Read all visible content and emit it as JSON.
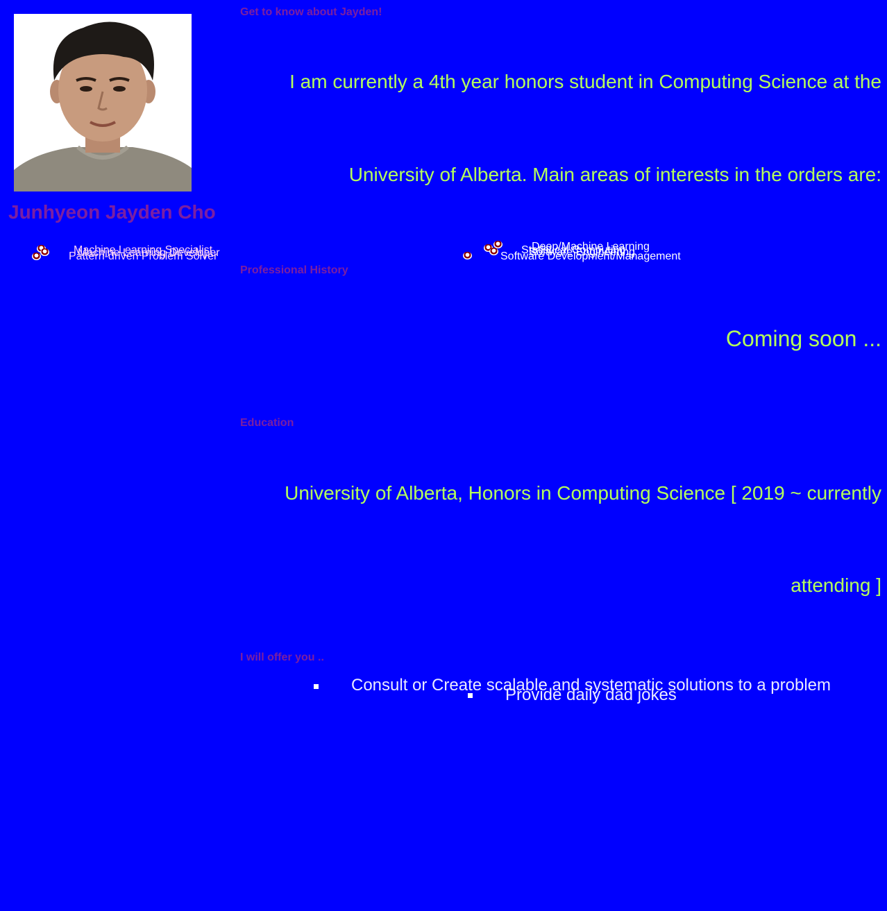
{
  "sidebar": {
    "photo_alt": "Profile photo of Junhyeon Jayden Cho",
    "name": "Junhyeon Jayden Cho",
    "skills_left": [
      "Machine Learning Specialist",
      "Machine Learning Developer",
      "Pattern-driven Problem Solver"
    ]
  },
  "skills_right": [
    "Deep/Machine Learning",
    "Statistical Computing",
    "Software Development/Management",
    "Software Engineering"
  ],
  "about": {
    "title": "Get to know about Jayden!",
    "line1": "I am currently a 4th year honors student in Computing Science at the",
    "line2": "University of Alberta. Main areas of interests in the orders are:"
  },
  "professional": {
    "title": "Professional History",
    "text": "Coming soon ..."
  },
  "education": {
    "title": "Education",
    "line1": "University of Alberta, Honors in Computing Science [ 2019 ~ currently",
    "line2": "attending ]"
  },
  "offer": {
    "title": "I will offer you ..",
    "items": [
      "Consult or Create scalable and systematic solutions to a problem",
      "Provide daily dad jokes"
    ]
  },
  "colors": {
    "background": "#0000ff",
    "heading": "#7b1fa2",
    "highlight_text": "#b5ff5b"
  }
}
